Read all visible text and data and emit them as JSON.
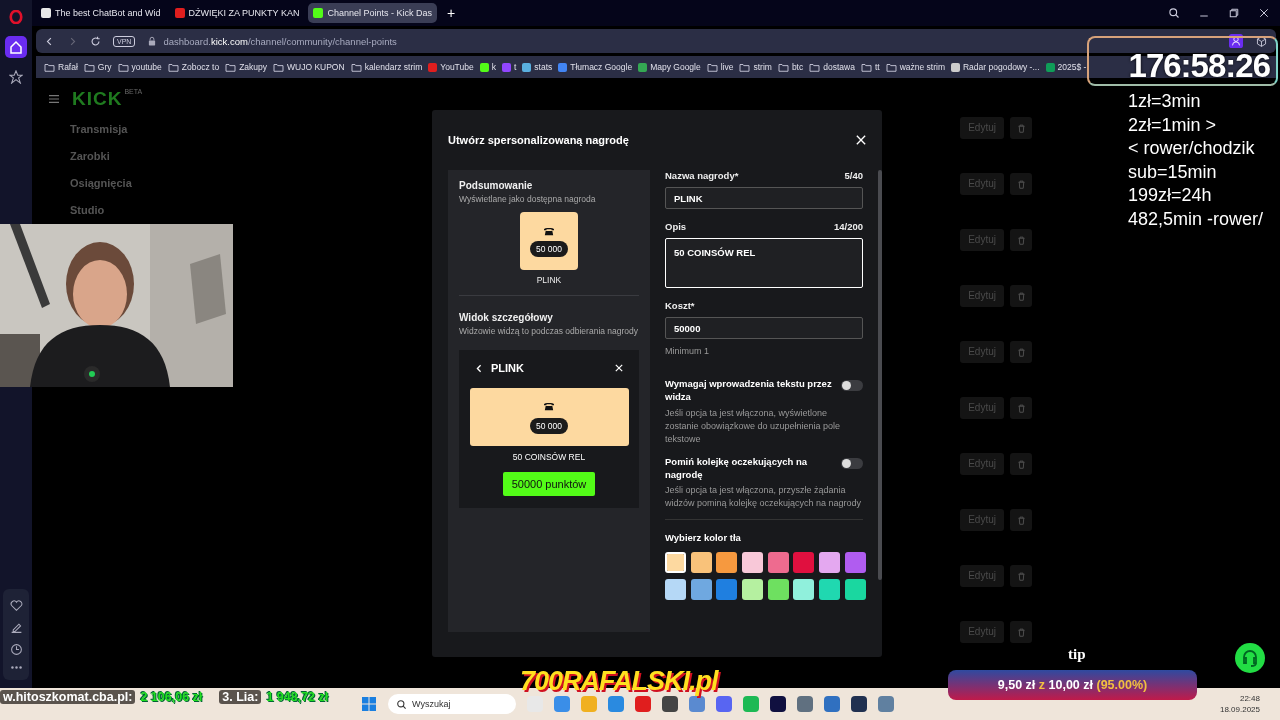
{
  "browser": {
    "tabs": [
      {
        "title": "The best ChatBot and Wid",
        "selected": false,
        "color": "#e8e8e8"
      },
      {
        "title": "DŹWIĘKI ZA PUNKTY KAN",
        "selected": false,
        "color": "#e01e1e"
      },
      {
        "title": "Channel Points - Kick Das",
        "selected": true,
        "color": "#53fc18"
      }
    ],
    "new_tab": "+",
    "vpn": "VPN",
    "url": "dashboard.**kick.com**/channel/community/channel-points",
    "bookmarks": [
      {
        "label": "Rafał",
        "kind": "folder"
      },
      {
        "label": "Gry",
        "kind": "folder"
      },
      {
        "label": "youtube",
        "kind": "folder"
      },
      {
        "label": "Zobocz to",
        "kind": "folder"
      },
      {
        "label": "Zakupy",
        "kind": "folder"
      },
      {
        "label": "WUJO KUPON",
        "kind": "folder"
      },
      {
        "label": "kalendarz strim",
        "kind": "folder"
      },
      {
        "label": "YouTube",
        "kind": "site",
        "color": "#e01e1e"
      },
      {
        "label": "k",
        "kind": "site",
        "color": "#53fc18"
      },
      {
        "label": "t",
        "kind": "site",
        "color": "#9146ff"
      },
      {
        "label": "stats",
        "kind": "site",
        "color": "#5ab0e0"
      },
      {
        "label": "Tłumacz Google",
        "kind": "site",
        "color": "#4285f4"
      },
      {
        "label": "Mapy Google",
        "kind": "site",
        "color": "#34a853"
      },
      {
        "label": "live",
        "kind": "folder"
      },
      {
        "label": "strim",
        "kind": "folder"
      },
      {
        "label": "btc",
        "kind": "folder"
      },
      {
        "label": "dostawa",
        "kind": "folder"
      },
      {
        "label": "tt",
        "kind": "folder"
      },
      {
        "label": "ważne strim",
        "kind": "folder"
      },
      {
        "label": "Radar pogodowy -...",
        "kind": "site",
        "color": "#cccccc"
      },
      {
        "label": "2025$ -",
        "kind": "site",
        "color": "#0f9d58"
      }
    ]
  },
  "kick": {
    "logo": "KICK",
    "badge": "BETA",
    "menu": [
      {
        "label": "Transmisja"
      },
      {
        "label": "Zarobki"
      },
      {
        "label": "Osiągnięcia"
      },
      {
        "label": "Studio"
      }
    ],
    "rows": [
      {
        "action": "Edytuj"
      },
      {
        "action": "Edytuj"
      },
      {
        "action": "Edytuj"
      },
      {
        "action": "Edytuj"
      },
      {
        "action": "Edytuj"
      },
      {
        "action": "Edytuj"
      },
      {
        "action": "Edytuj"
      },
      {
        "action": "Edytuj"
      },
      {
        "action": "Edytuj"
      },
      {
        "action": "Edytuj"
      }
    ]
  },
  "dialog": {
    "title": "Utwórz spersonalizowaną nagrodę",
    "summary": {
      "title": "Podsumowanie",
      "subtitle": "Wyświetlane jako dostępna nagroda",
      "cost": "50 000",
      "name": "PLINK"
    },
    "detail": {
      "title": "Widok szczegółowy",
      "subtitle": "Widzowie widzą to podczas odbierania nagrody",
      "name": "PLINK",
      "cost": "50 000",
      "description": "50 COINSÓW REL",
      "redeem": "50000 punktów"
    },
    "fields": [
      {
        "label": "Nazwa nagrody*",
        "count": "5/40",
        "value": "PLINK",
        "focused": false,
        "multiline": false
      },
      {
        "label": "Opis",
        "count": "14/200",
        "value": "50 COINSÓW REL",
        "focused": true,
        "multiline": true
      },
      {
        "label": "Koszt*",
        "value": "50000",
        "hint": "Minimum 1",
        "focused": false,
        "multiline": false
      }
    ],
    "toggles": [
      {
        "label": "Wymagaj wprowadzenia tekstu przez widza",
        "description": "Jeśli opcja ta jest włączona, wyświetlone zostanie obowiązkowe do uzupełnienia pole tekstowe",
        "on": false
      },
      {
        "label": "Pomiń kolejkę oczekujących na nagrodę",
        "description": "Jeśli opcja ta jest włączona, przyszłe żądania widzów pominą kolejkę oczekujących na nagrody",
        "on": false
      }
    ],
    "color_title": "Wybierz kolor tła",
    "swatches": [
      {
        "color": "#fdd9a0",
        "selected": true
      },
      {
        "color": "#f9c27a",
        "selected": false
      },
      {
        "color": "#f6993f",
        "selected": false
      },
      {
        "color": "#f8c8d8",
        "selected": false
      },
      {
        "color": "#ee6b8f",
        "selected": false
      },
      {
        "color": "#e0103f",
        "selected": false
      },
      {
        "color": "#e4a8f0",
        "selected": false
      },
      {
        "color": "#b05cf0",
        "selected": false
      },
      {
        "color": "#b5d8f6",
        "selected": false
      },
      {
        "color": "#6fa8e0",
        "selected": false
      },
      {
        "color": "#1f7fe0",
        "selected": false
      },
      {
        "color": "#b5f0a0",
        "selected": false
      },
      {
        "color": "#6ee060",
        "selected": false
      },
      {
        "color": "#90f0dc",
        "selected": false
      },
      {
        "color": "#20d8b0",
        "selected": false
      },
      {
        "color": "#1ad7a0",
        "selected": false
      }
    ]
  },
  "overlay": {
    "timer": "176:58:26",
    "notes": [
      "1zł=3min",
      "2zł=1min >",
      "< rower/chodzik",
      "sub=15min",
      "199zł=24h",
      "482,5min -rower/"
    ]
  },
  "tip": {
    "label": "tip",
    "amount": "9,50 zł",
    "sep": "z",
    "goal": "10,00 zł",
    "percent": "(95.00%)"
  },
  "brand": "700RAFALSKI.pl",
  "ticker": [
    {
      "name": "w.hitoszkomat.cba.pl:",
      "amount": "2 106,06 zł"
    },
    {
      "name": "3. Lia:",
      "amount": "1 948,72 zł"
    }
  ],
  "taskbar": {
    "search": "Wyszukaj",
    "time": "22:48",
    "date": "18.09.2025"
  }
}
